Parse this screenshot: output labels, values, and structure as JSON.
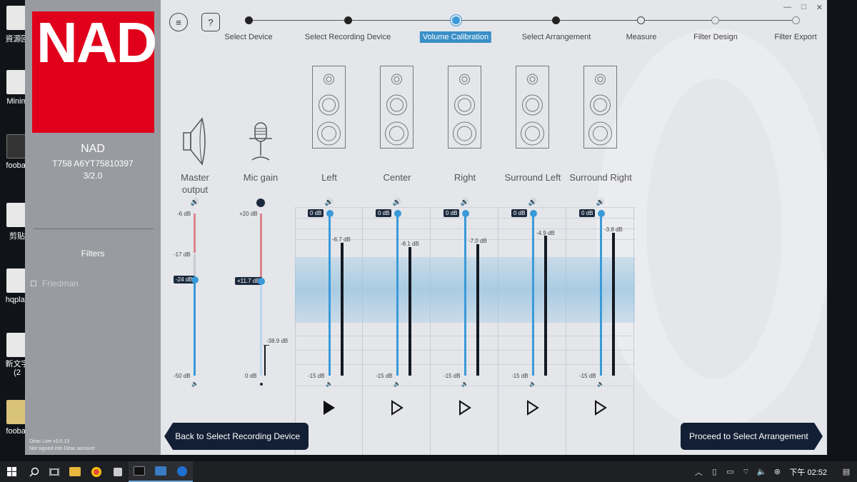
{
  "desktop": {
    "icons": [
      {
        "label": "資源回"
      },
      {
        "label": "Minim"
      },
      {
        "label": "foobar"
      },
      {
        "label": "剪贴"
      },
      {
        "label": "hqplay"
      },
      {
        "label": "新文字\n(2"
      },
      {
        "label": "foobar"
      }
    ]
  },
  "window_controls": {
    "minimize": "—",
    "maximize": "□",
    "close": "✕"
  },
  "sidebar": {
    "logo_text": "NAD",
    "device_name": "NAD",
    "serial": "T758 A6YT75810397",
    "config": "3/2.0",
    "filters_title": "Filters",
    "filter_items": [
      "Friedman"
    ],
    "version": "Dirac Live v3.0.13",
    "account": "Not signed into Dirac account"
  },
  "header": {
    "menu_icon": "≡",
    "help_icon": "?",
    "steps": [
      {
        "label": "Select Device",
        "state": "done"
      },
      {
        "label": "Select Recording Device",
        "state": "done"
      },
      {
        "label": "Volume Calibration",
        "state": "current"
      },
      {
        "label": "Select Arrangement",
        "state": "done"
      },
      {
        "label": "Measure",
        "state": "todo"
      },
      {
        "label": "Filter Design",
        "state": "todo"
      },
      {
        "label": "Filter Export",
        "state": "todo"
      }
    ]
  },
  "master": {
    "label1": "Master",
    "label2": "output",
    "top_label": "-6 dB",
    "mid_label": "-17 dB",
    "value": "-24 dB",
    "bottom_label": "-50 dB"
  },
  "mic": {
    "label": "Mic gain",
    "top_label": "+20 dB",
    "value": "+11.7 dB",
    "level": "-38.9 dB",
    "bottom_label": "0 dB"
  },
  "channels": [
    {
      "name": "Left",
      "gain": "0 dB",
      "level": "-6.7 dB",
      "bottom": "-15 dB",
      "selected": true
    },
    {
      "name": "Center",
      "gain": "0 dB",
      "level": "-8.1 dB",
      "bottom": "-15 dB",
      "selected": false
    },
    {
      "name": "Right",
      "gain": "0 dB",
      "level": "-7.0 dB",
      "bottom": "-15 dB",
      "selected": false
    },
    {
      "name": "Surround Left",
      "gain": "0 dB",
      "level": "-4.9 dB",
      "bottom": "-15 dB",
      "selected": false
    },
    {
      "name": "Surround Right",
      "gain": "0 dB",
      "level": "-3.8 dB",
      "bottom": "-15 dB",
      "selected": false
    }
  ],
  "nav": {
    "back": "Back to Select Recording Device",
    "next": "Proceed to Select Arrangement"
  },
  "taskbar": {
    "clock": "下午 02:52",
    "pinned": [
      "file-explorer",
      "chrome",
      "foobar",
      "terminal",
      "photos",
      "dirac-live"
    ]
  },
  "colors": {
    "accent": "#3a9ad9",
    "nad_red": "#e0001b",
    "dark_navy": "#131f35",
    "master_top_red": "#d9868a"
  }
}
